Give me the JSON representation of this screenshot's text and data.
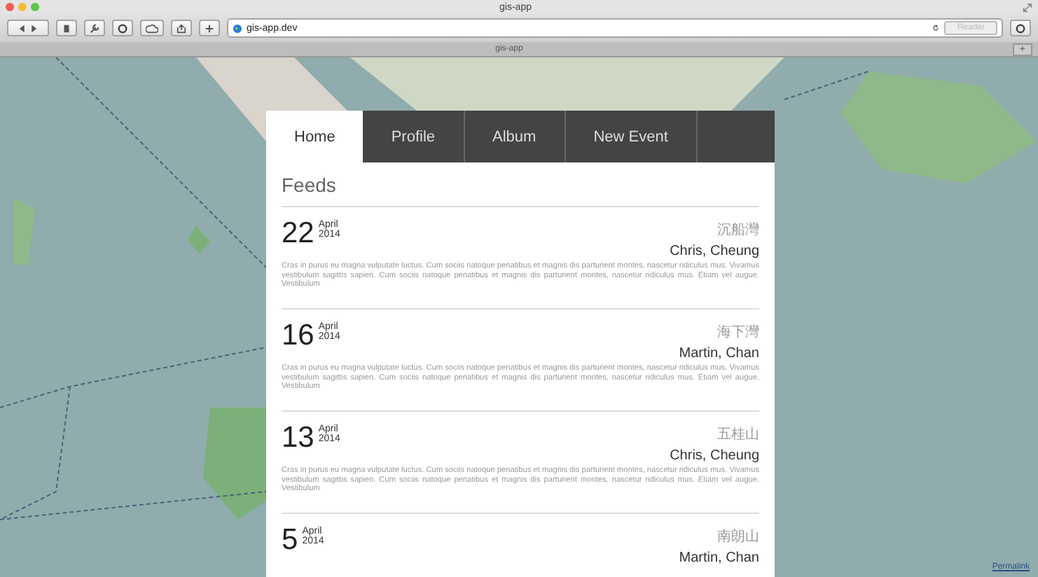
{
  "window": {
    "title": "gis-app"
  },
  "toolbar": {
    "url": "gis-app.dev",
    "reader": {
      "label": "Reader",
      "disabled": true
    }
  },
  "tabs_bar": {
    "tab": "gis-app",
    "new_tab": "+"
  },
  "map": {
    "permalink": "Permalink"
  },
  "nav": [
    {
      "label": "Home",
      "selected": true
    },
    {
      "label": "Profile",
      "selected": false
    },
    {
      "label": "Album",
      "selected": false
    },
    {
      "label": "New Event",
      "selected": false
    }
  ],
  "heading": "Feeds",
  "feeds": [
    {
      "day": "22",
      "month": "April",
      "year": "2014",
      "place": "沉船灣",
      "name": "Chris, Cheung",
      "body": "Cras in purus eu magna vulputate luctus. Cum sociis natoque penatibus et magnis dis parturient montes, nascetur ridiculus mus. Vivamus vestibulum sagittis sapien. Cum sociis natoque penatibus et magnis dis parturient montes, nascetur ridiculus mus. Etiam vel augue. Vestibulum"
    },
    {
      "day": "16",
      "month": "April",
      "year": "2014",
      "place": "海下灣",
      "name": "Martin, Chan",
      "body": "Cras in purus eu magna vulputate luctus. Cum sociis natoque penatibus et magnis dis parturient montes, nascetur ridiculus mus. Vivamus vestibulum sagittis sapien. Cum sociis natoque penatibus et magnis dis parturient montes, nascetur ridiculus mus. Etiam vel augue. Vestibulum"
    },
    {
      "day": "13",
      "month": "April",
      "year": "2014",
      "place": "五桂山",
      "name": "Chris, Cheung",
      "body": "Cras in purus eu magna vulputate luctus. Cum sociis natoque penatibus et magnis dis parturient montes, nascetur ridiculus mus. Vivamus vestibulum sagittis sapien. Cum sociis natoque penatibus et magnis dis parturient montes, nascetur ridiculus mus. Etiam vel augue. Vestibulum"
    },
    {
      "day": "5",
      "month": "April",
      "year": "2014",
      "place": "南朗山",
      "name": "Martin, Chan"
    }
  ]
}
